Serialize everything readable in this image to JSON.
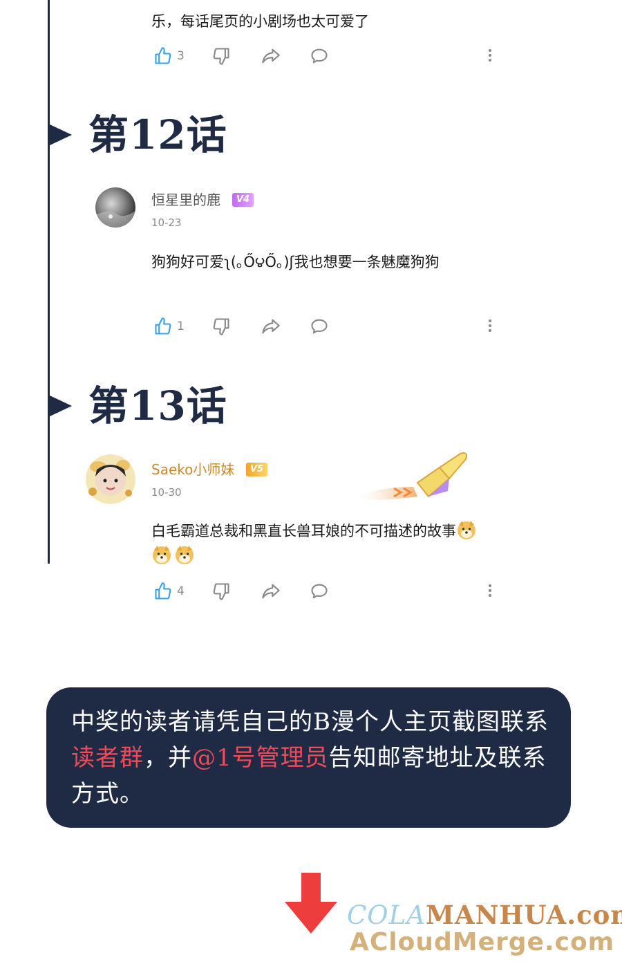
{
  "top_comment": {
    "text": "乐，每话尾页的小剧场也太可爱了",
    "likes": "3"
  },
  "chapters": [
    {
      "title": "第12话",
      "comment": {
        "username": "恒星里的鹿",
        "vip_label": "V4",
        "date": "10-23",
        "text": "狗狗好可爱ʅ(｡Ő౪Ő｡)ʃ我也想要一条魅魔狗狗",
        "likes": "1"
      }
    },
    {
      "title": "第13话",
      "comment": {
        "username": "Saeko小师妹",
        "vip_label": "V5",
        "date": "10-30",
        "text": "白毛霸道总裁和黑直长兽耳娘的不可描述的故事",
        "likes": "4",
        "emoji": [
          "shiba-emoji",
          "shiba-emoji",
          "shiba-emoji"
        ]
      }
    }
  ],
  "notice": {
    "part1": "中奖的读者请凭自己的B漫个人主页截图联系",
    "highlight1": "读者群",
    "part2": "，并",
    "highlight2": "@1号管理员",
    "part3": "告知邮寄地址及联系方式。"
  },
  "watermark": {
    "line1_a": "COLA",
    "line1_b": "MANHUA.com",
    "line2": "ACloudMerge.com"
  },
  "colors": {
    "navy": "#1f2a44",
    "highlight": "#f04a5a",
    "v4_badge": "#c06be8",
    "v5_badge": "#f2a42b",
    "username_gold": "#c9892c",
    "like_blue": "#3aa0e8"
  },
  "icons": {
    "like": "thumb-up-icon",
    "dislike": "thumb-down-icon",
    "share": "share-icon",
    "reply": "comment-icon",
    "more": "more-vertical-icon"
  }
}
